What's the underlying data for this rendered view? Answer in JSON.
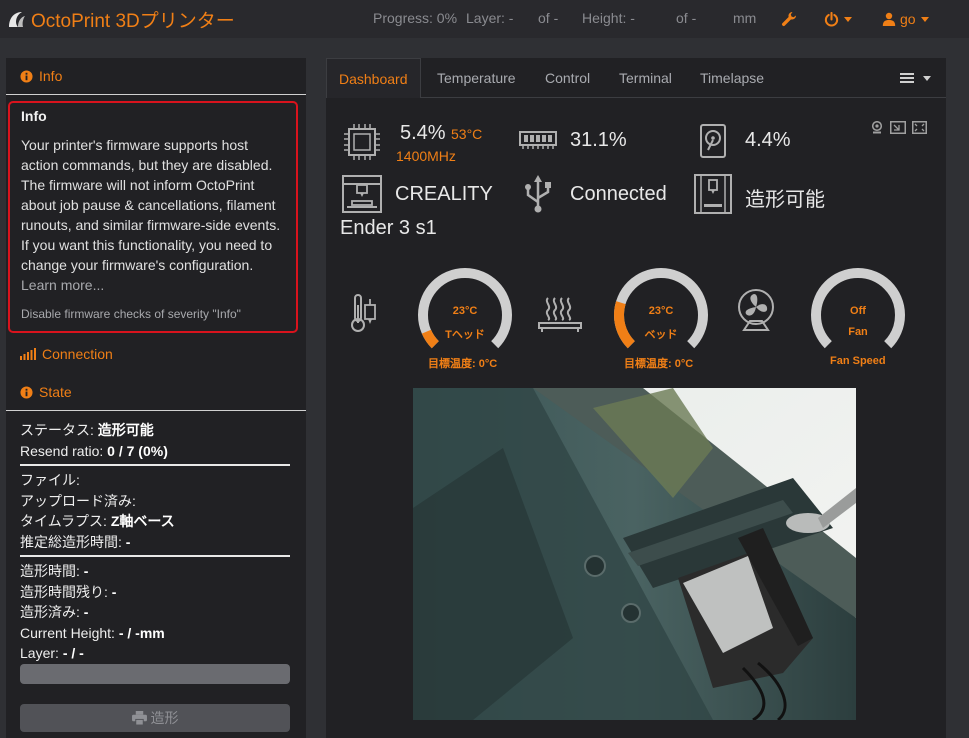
{
  "brand": {
    "title": "OctoPrint 3Dプリンター"
  },
  "navbar": {
    "progress_label": "Progress: 0%",
    "layer_label": "Layer: -",
    "layer_of": "of -",
    "height_label": "Height: -",
    "height_of": "of -",
    "height_unit": "mm",
    "user_label": "go"
  },
  "sidebar": {
    "info_header": "Info",
    "alert": {
      "title": "Info",
      "body": "Your printer's firmware supports host action commands, but they are disabled. The firmware will not inform OctoPrint about job pause & cancellations, filament runouts, and similar firmware-side events. If you want this functionality, you need to change your firmware's configuration.",
      "learn_more": "Learn more...",
      "disable": "Disable firmware checks of severity \"Info\""
    },
    "connection_header": "Connection",
    "state_header": "State",
    "state": {
      "status_key": "ステータス:",
      "status_val": "造形可能",
      "resend_key": "Resend ratio:",
      "resend_val": "0 / 7 (0%)",
      "file_key": "ファイル:",
      "uploaded_key": "アップロード済み:",
      "timelapse_key": "タイムラプス:",
      "timelapse_val": "Z軸ベース",
      "est_key": "推定総造形時間:",
      "est_val": "-",
      "print_time_key": "造形時間:",
      "print_time_val": "-",
      "remaining_key": "造形時間残り:",
      "remaining_val": "-",
      "printed_key": "造形済み:",
      "printed_val": "-",
      "height_key": "Current Height:",
      "height_val": "- / -mm",
      "layer_key": "Layer:",
      "layer_val": "- / -"
    },
    "progress_percent": 0,
    "print_button": "造形"
  },
  "tabs": [
    "Dashboard",
    "Temperature",
    "Control",
    "Terminal",
    "Timelapse"
  ],
  "dashboard": {
    "cpu_percent": "5.4%",
    "cpu_temp": "53°C",
    "cpu_freq": "1400MHz",
    "mem_percent": "31.1%",
    "disk_percent": "4.4%",
    "printer_brand": "CREALITY",
    "printer_model": "Ender 3 s1",
    "connection_status": "Connected",
    "printer_status": "造形可能",
    "hotend": {
      "temp": "23°C",
      "label": "Tヘッド",
      "target": "目標温度: 0°C",
      "fraction": 0.08
    },
    "bed": {
      "temp": "23°C",
      "label": "ベッド",
      "target": "目標温度: 0°C",
      "fraction": 0.23
    },
    "fan": {
      "value": "Off",
      "label": "Fan",
      "caption": "Fan Speed",
      "fraction": 0
    }
  },
  "colors": {
    "accent": "#f07f16",
    "alert_border": "#d9131d",
    "bg": "#2f3034",
    "panel": "#212124"
  }
}
